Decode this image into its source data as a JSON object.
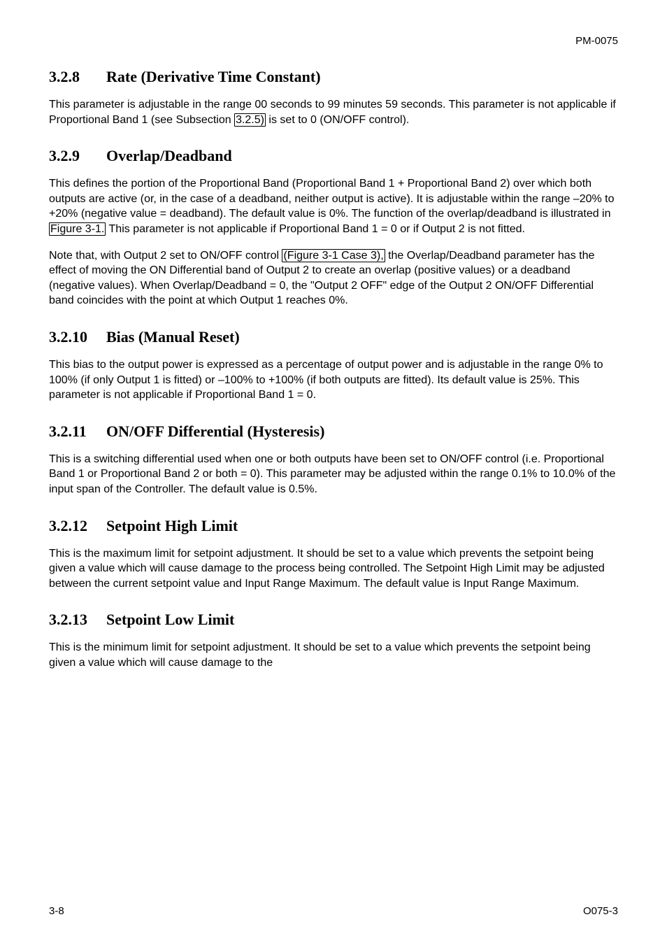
{
  "header": {
    "doc_id": "PM-0075"
  },
  "sections": [
    {
      "num": "3.2.8",
      "title": "Rate (Derivative Time Constant)",
      "paras": [
        {
          "runs": [
            {
              "t": "This parameter is adjustable in the range 00 seconds to 99 minutes 59 seconds. This parameter is not applicable if Proportional Band 1 (see Subsection "
            },
            {
              "t": "3.2.5)",
              "link": true
            },
            {
              "t": " is set to 0 (ON/OFF control)."
            }
          ]
        }
      ]
    },
    {
      "num": "3.2.9",
      "title": "Overlap/Deadband",
      "paras": [
        {
          "runs": [
            {
              "t": "This defines the portion of the Proportional Band (Proportional Band 1 + Proportional Band 2) over which both outputs are active (or, in the case of a deadband, neither output is active). It is adjustable within the range –20% to +20% (negative value = deadband). The default value is 0%. The function of the overlap/deadband is illustrated in "
            },
            {
              "t": "Figure 3-1.",
              "link": true
            },
            {
              "t": " This parameter is not applicable if Proportional Band 1 = 0 or if Output 2 is not fitted."
            }
          ]
        },
        {
          "runs": [
            {
              "t": "Note that, with Output 2 set to ON/OFF control "
            },
            {
              "t": "(Figure 3-1 Case 3),",
              "link": true
            },
            {
              "t": " the Overlap/Deadband parameter has the effect of moving the ON Differential band of Output 2 to create an overlap (positive values) or a deadband (negative values). When Overlap/Deadband = 0, the \"Output 2 OFF\" edge of the Output 2 ON/OFF Differential band coincides with the point at which Output 1 reaches 0%."
            }
          ]
        }
      ]
    },
    {
      "num": "3.2.10",
      "title": "Bias (Manual Reset)",
      "paras": [
        {
          "runs": [
            {
              "t": "This bias to the output power is expressed as a percentage of output power and is adjustable in the range 0% to 100% (if only Output 1 is fitted) or –100% to +100% (if both outputs are fitted). Its default value is 25%. This parameter is not applicable if Proportional Band 1 = 0."
            }
          ]
        }
      ]
    },
    {
      "num": "3.2.11",
      "title": "ON/OFF Differential (Hysteresis)",
      "paras": [
        {
          "runs": [
            {
              "t": "This is a switching differential used when one or both outputs have been set to ON/OFF control (i.e. Proportional Band 1 or Proportional Band 2 or both = 0). This parameter may be adjusted within the range 0.1% to 10.0% of the input span of the Controller. The default value is 0.5%."
            }
          ]
        }
      ]
    },
    {
      "num": "3.2.12",
      "title": "Setpoint High Limit",
      "paras": [
        {
          "runs": [
            {
              "t": "This is the maximum limit for setpoint adjustment. It should be set to a value which prevents the setpoint being given a value which will cause damage to the process being controlled. The Setpoint High Limit may be adjusted between the current setpoint value and Input Range Maximum. The default value is Input Range Maximum."
            }
          ]
        }
      ]
    },
    {
      "num": "3.2.13",
      "title": "Setpoint Low Limit",
      "paras": [
        {
          "runs": [
            {
              "t": "This is the minimum limit for setpoint adjustment. It should be set to a value which prevents the setpoint being given a value which will cause damage to the"
            }
          ]
        }
      ]
    }
  ],
  "footer": {
    "left": "3-8",
    "right": "O075-3"
  }
}
